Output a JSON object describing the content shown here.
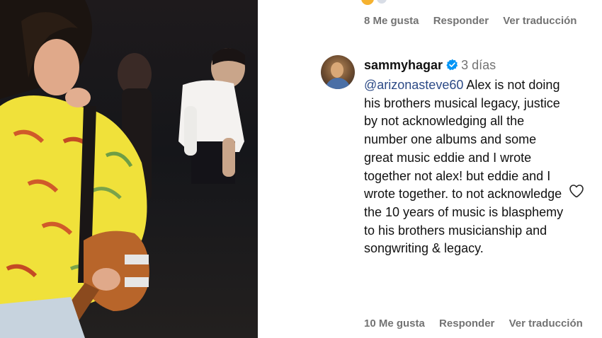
{
  "post_photo": {
    "alt_icon": "photo"
  },
  "previous_comment": {
    "likes": "8 Me gusta",
    "reply": "Responder",
    "translate": "Ver traducción"
  },
  "comment": {
    "username": "sammyhagar",
    "verified_icon": "verified-badge-icon",
    "time": "3 días",
    "mention": "@arizonasteve60",
    "text": " Alex is not doing his brothers musical legacy, justice by not acknowledging all the number one albums and some great music eddie and I wrote together not alex! but eddie and I wrote together. to not acknowledge the 10 years of music is blasphemy to his brothers musicianship and songwriting & legacy.",
    "likes": "10 Me gusta",
    "reply": "Responder",
    "translate": "Ver traducción",
    "like_icon": "heart-outline-icon"
  },
  "colors": {
    "meta_gray": "#737373",
    "mention_blue": "#2c4a86",
    "verified_blue": "#0095f6",
    "text": "#111111"
  }
}
